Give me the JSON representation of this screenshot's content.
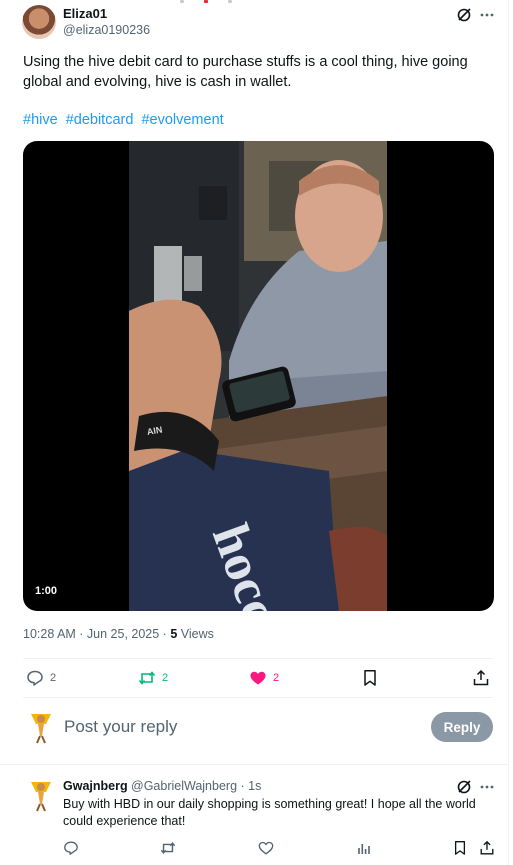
{
  "author": {
    "name": "Eliza01",
    "handle": "@eliza0190236"
  },
  "tweet": {
    "text": "Using the hive debit card to purchase stuffs is a cool thing, hive going global and evolving, hive is cash in wallet.",
    "hashtags": [
      "#hive",
      "#debitcard",
      "#evolvement"
    ],
    "video": {
      "duration": "1:00",
      "mat_text": "hocc",
      "wristband_text": "AIN"
    },
    "timestamp": "10:28 AM · Jun 25, 2025 · ",
    "views_count": "5",
    "views_label": " Views"
  },
  "actions": {
    "reply_count": "2",
    "repost_count": "2",
    "like_count": "2"
  },
  "composer": {
    "placeholder": "Post your reply",
    "reply_label": "Reply"
  },
  "reply": {
    "name": "Gwajnberg",
    "handle": "@GabrielWajnberg · 1s",
    "text": "Buy with HBD in our daily shopping is something great! I hope all the world could experience that!"
  },
  "colors": {
    "accent": "#1d9bf0",
    "like": "#f91880",
    "repost": "#00ba7c",
    "muted": "#536471"
  },
  "icons": [
    "grok-icon",
    "more-icon",
    "reply-icon",
    "repost-icon",
    "heart-filled-icon",
    "bookmark-icon",
    "share-icon",
    "views-icon",
    "heart-icon"
  ]
}
